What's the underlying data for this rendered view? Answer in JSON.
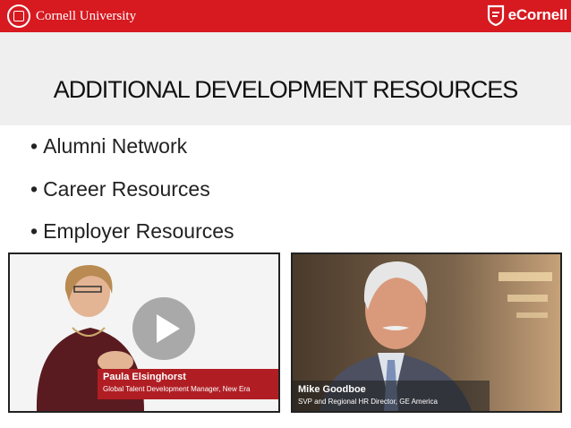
{
  "header": {
    "university_name": "Cornell University",
    "brand_name": "eCornell",
    "bar_color": "#d71920"
  },
  "slide": {
    "title": "ADDITIONAL DEVELOPMENT RESOURCES",
    "bullets": [
      "Alumni Network",
      "Career Resources",
      "Employer Resources"
    ]
  },
  "videos": [
    {
      "speaker_name": "Paula Elsinghorst",
      "speaker_title": "Global Talent Development Manager, New Era",
      "icon": "play-icon"
    },
    {
      "speaker_name": "Mike Goodboe",
      "speaker_title": "SVP and Regional HR Director, GE America"
    }
  ]
}
